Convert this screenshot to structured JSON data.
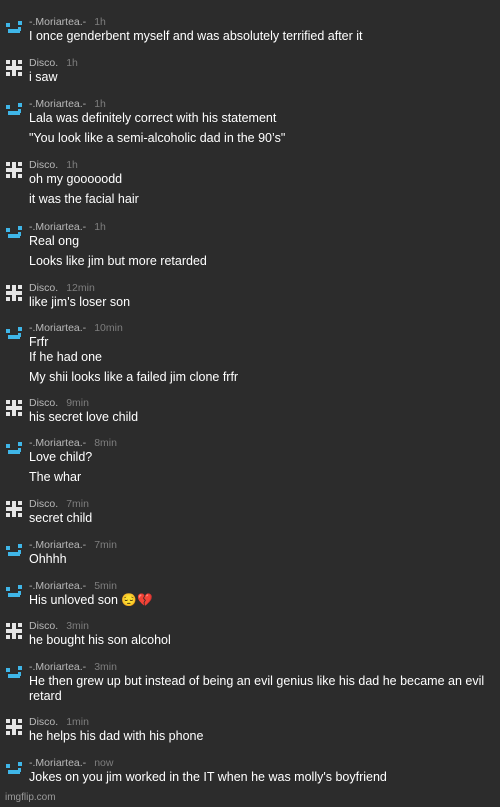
{
  "colors": {
    "background": "#2c2c2c",
    "username": "#b9b9b9",
    "timestamp": "#7e7e7e",
    "text": "#ffffff",
    "moriartea_avatar": "#3fb6e8",
    "disco_avatar": "#e6e6e6"
  },
  "messages": [
    {
      "user": "-.Moriartea.-",
      "avatar": "moriartea",
      "time": "1h",
      "lines": [
        "I once genderbent myself and was absolutely terrified after it"
      ]
    },
    {
      "user": "Disco.",
      "avatar": "disco",
      "time": "1h",
      "lines": [
        "i saw"
      ]
    },
    {
      "user": "-.Moriartea.-",
      "avatar": "moriartea",
      "time": "1h",
      "lines": [
        "Lala was definitely correct with his statement",
        "\"You look like a semi-alcoholic dad in the 90’s\""
      ]
    },
    {
      "user": "Disco.",
      "avatar": "disco",
      "time": "1h",
      "lines": [
        "oh my gooooodd",
        "it was the facial hair"
      ]
    },
    {
      "user": "-.Moriartea.-",
      "avatar": "moriartea",
      "time": "1h",
      "lines": [
        "Real ong",
        "Looks like jim but more retarded"
      ]
    },
    {
      "user": "Disco.",
      "avatar": "disco",
      "time": "12min",
      "lines": [
        "like jim's loser son"
      ]
    },
    {
      "user": "-.Moriartea.-",
      "avatar": "moriartea",
      "time": "10min",
      "lines": [
        "Frfr",
        "If he had one",
        "My shii looks like a failed jim clone frfr"
      ]
    },
    {
      "user": "Disco.",
      "avatar": "disco",
      "time": "9min",
      "lines": [
        "his secret love child"
      ]
    },
    {
      "user": "-.Moriartea.-",
      "avatar": "moriartea",
      "time": "8min",
      "lines": [
        "Love child?",
        "The whar"
      ]
    },
    {
      "user": "Disco.",
      "avatar": "disco",
      "time": "7min",
      "lines": [
        "secret child"
      ]
    },
    {
      "user": "-.Moriartea.-",
      "avatar": "moriartea",
      "time": "7min",
      "lines": [
        "Ohhhh"
      ]
    },
    {
      "user": "-.Moriartea.-",
      "avatar": "moriartea",
      "time": "5min",
      "lines": [
        "His unloved son 😔💔"
      ]
    },
    {
      "user": "Disco.",
      "avatar": "disco",
      "time": "3min",
      "lines": [
        "he bought his son alcohol"
      ]
    },
    {
      "user": "-.Moriartea.-",
      "avatar": "moriartea",
      "time": "3min",
      "lines": [
        "He then grew up but instead of being an evil genius like his dad he became an evil retard"
      ]
    },
    {
      "user": "Disco.",
      "avatar": "disco",
      "time": "1min",
      "lines": [
        "he helps his dad with his phone"
      ]
    },
    {
      "user": "-.Moriartea.-",
      "avatar": "moriartea",
      "time": "now",
      "lines": [
        "Jokes on you jim worked in the IT when he was molly's boyfriend"
      ]
    }
  ],
  "watermark": "imgflip.com"
}
